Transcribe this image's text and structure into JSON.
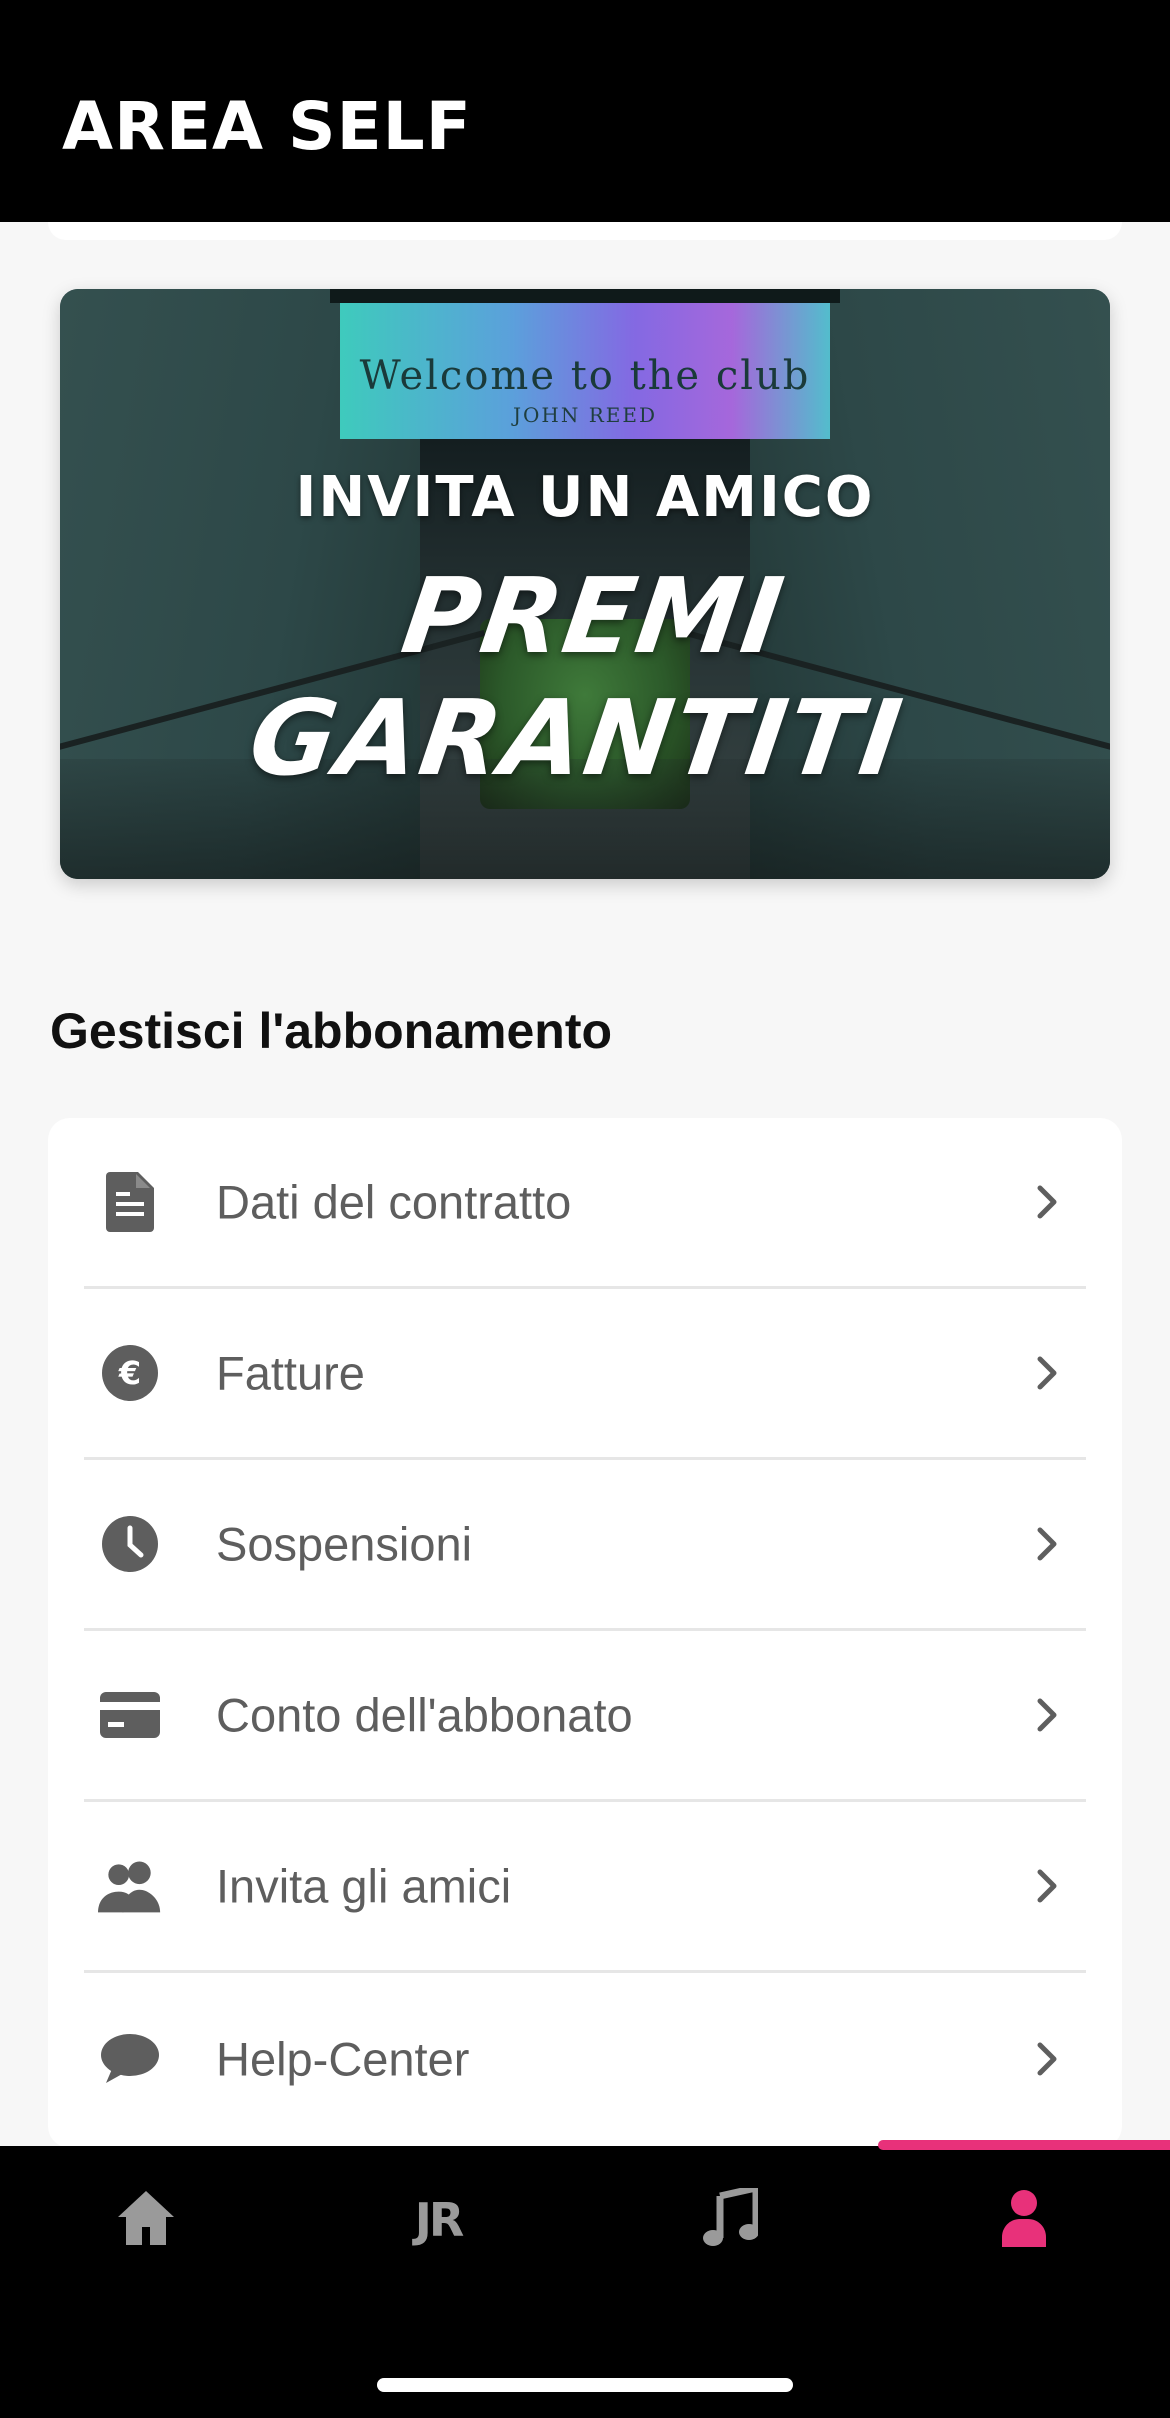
{
  "header": {
    "title": "AREA SELF"
  },
  "banner": {
    "line1": "INVITA UN AMICO",
    "line2": "PREMI GARANTITI",
    "sign_text": "Welcome to the club",
    "sign_sub": "JOHN REED"
  },
  "section": {
    "title": "Gestisci l'abbonamento",
    "items": [
      {
        "label": "Dati del contratto",
        "icon": "document-icon"
      },
      {
        "label": "Fatture",
        "icon": "euro-icon"
      },
      {
        "label": "Sospensioni",
        "icon": "clock-icon"
      },
      {
        "label": "Conto dell'abbonato",
        "icon": "credit-card-icon"
      },
      {
        "label": "Invita gli amici",
        "icon": "people-icon"
      },
      {
        "label": "Help-Center",
        "icon": "chat-bubble-icon"
      }
    ]
  },
  "bottom_nav": {
    "tabs": [
      {
        "name": "home",
        "icon": "home-icon",
        "active": false
      },
      {
        "name": "jr",
        "icon": "jr-logo-icon",
        "text": "JR",
        "active": false
      },
      {
        "name": "music",
        "icon": "music-note-icon",
        "active": false
      },
      {
        "name": "profile",
        "icon": "user-icon",
        "active": true
      }
    ],
    "active_color": "#e8317a",
    "inactive_color": "#9a9a9a"
  }
}
